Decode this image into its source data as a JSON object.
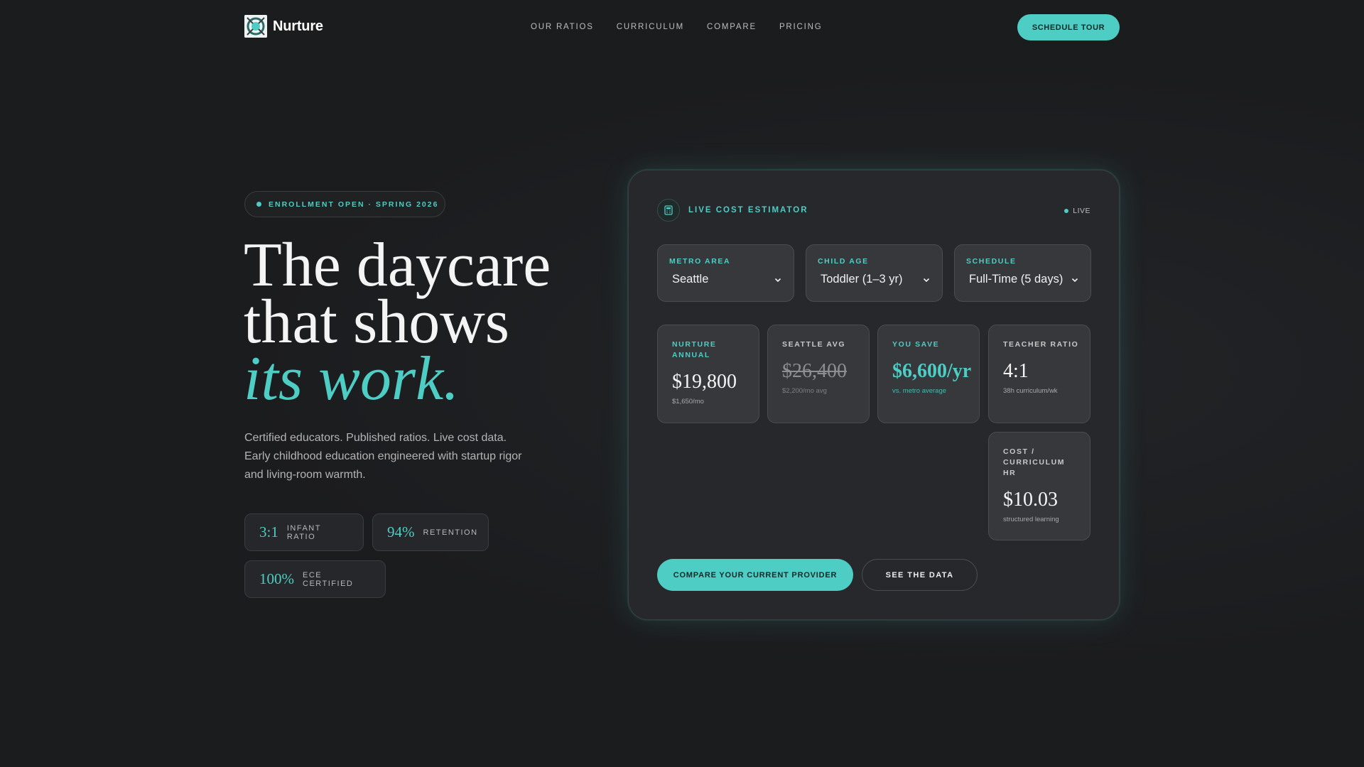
{
  "brand": {
    "name": "Nurture"
  },
  "nav": {
    "links": [
      "OUR RATIOS",
      "CURRICULUM",
      "COMPARE",
      "PRICING"
    ],
    "cta": "SCHEDULE TOUR"
  },
  "hero": {
    "badge": "ENROLLMENT OPEN · SPRING 2026",
    "headline_line1": "The daycare",
    "headline_line2": "that shows",
    "headline_accent": "its work.",
    "subcopy": "Certified educators. Published ratios. Live cost data. Early childhood education engineered with startup rigor and living-room warmth.",
    "stats": [
      {
        "value": "3:1",
        "label": "INFANT RATIO"
      },
      {
        "value": "94%",
        "label": "RETENTION"
      },
      {
        "value": "100%",
        "label": "ECE CERTIFIED"
      }
    ]
  },
  "estimator": {
    "title": "LIVE COST ESTIMATOR",
    "live_label": "LIVE",
    "selects": [
      {
        "label": "METRO AREA",
        "value": "Seattle"
      },
      {
        "label": "CHILD AGE",
        "value": "Toddler (1–3 yr)"
      },
      {
        "label": "SCHEDULE",
        "value": "Full-Time (5 days)"
      }
    ],
    "metrics": [
      {
        "label": "NURTURE ANNUAL",
        "value": "$19,800",
        "sub": "$1,650/mo"
      },
      {
        "label": "SEATTLE AVG",
        "value": "$26,400",
        "sub": "$2,200/mo avg"
      },
      {
        "label": "YOU SAVE",
        "value": "$6,600/yr",
        "sub": "vs. metro average"
      },
      {
        "label": "TEACHER RATIO",
        "value": "4:1",
        "sub": "38h curriculum/wk"
      },
      {
        "label": "COST / CURRICULUM HR",
        "value": "$10.03",
        "sub": "structured learning"
      }
    ],
    "primary_cta": "COMPARE YOUR CURRENT PROVIDER",
    "secondary_cta": "SEE THE DATA"
  },
  "colors": {
    "accent": "#4ecdc4",
    "background": "#1b1c1e",
    "card": "#26282b"
  }
}
